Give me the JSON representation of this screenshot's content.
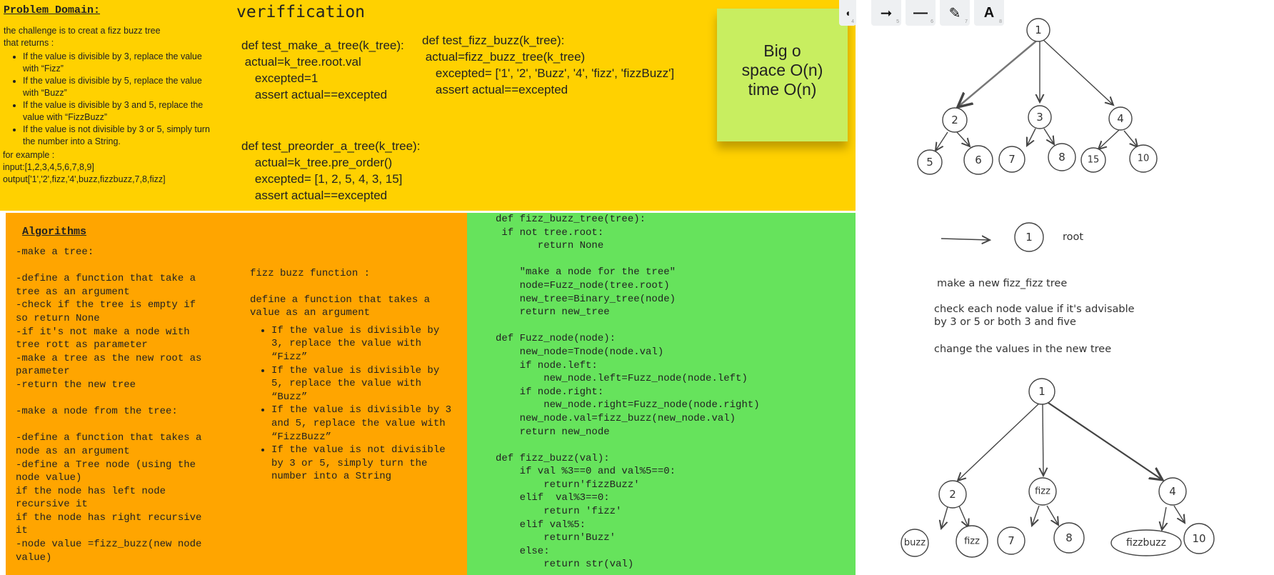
{
  "problem": {
    "title": "Problem Domain:",
    "intro": [
      "the challenge is to creat a fizz buzz tree",
      "that returns :"
    ],
    "rules": [
      "If the value is divisible by 3, replace the value with “Fizz”",
      "If the value is divisible by 5, replace the value with “Buzz”",
      "If the value is divisible by 3 and 5, replace the value with “FizzBuzz”",
      "If the value is not divisible by 3 or 5, simply turn the number into a String."
    ],
    "example_label": "for example :",
    "input": "input:[1,2,3,4,5,6,7,8,9]",
    "output": "output['1','2',fizz,'4',buzz,fizzbuzz,7,8,fizz]"
  },
  "verification": {
    "title": "veriffication",
    "test1": "def test_make_a_tree(k_tree):\n actual=k_tree.root.val\n    excepted=1\n    assert actual==excepted",
    "test2": "def test_fizz_buzz(k_tree):\n actual=fizz_buzz_tree(k_tree)\n    excepted= ['1', '2', 'Buzz', '4', 'fizz', 'fizzBuzz']\n    assert actual==excepted",
    "test3": "def test_preorder_a_tree(k_tree):\n    actual=k_tree.pre_order()\n    excepted= [1, 2, 5, 4, 3, 15]\n    assert actual==excepted"
  },
  "sticky": {
    "line1": "Big o",
    "line2": "space O(n)",
    "line3": "time O(n)"
  },
  "algorithms": {
    "title": "Algorithms",
    "steps": "-make a tree:\n\n-define a function that take a tree as an argument\n-check if the tree is empty if so return None\n-if it's not make a node with tree rott as parameter\n-make a tree as the new root as parameter\n-return the new tree\n\n-make a node from the tree:\n\n-define a function that takes a node as an argument\n-define a Tree node (using the node value)\nif the node has left node recursive it\nif the node has right recursive it\n-node value =fizz_buzz(new node value)",
    "fizz_title": "fizz buzz function :",
    "fizz_desc": "define a function that takes a value as an argument",
    "fizz_rules": [
      "If the value is divisible by 3, replace the value with “Fizz”",
      "If the value is divisible by 5, replace the value with “Buzz”",
      "If the value is divisible by 3 and 5, replace the value with “FizzBuzz”",
      "If the value is not divisible by 3 or 5, simply turn the number into a String"
    ]
  },
  "code": "def fizz_buzz_tree(tree):\n if not tree.root:\n       return None\n\n    \"make a node for the tree\"\n    node=Fuzz_node(tree.root)\n    new_tree=Binary_tree(node)\n    return new_tree\n\ndef Fuzz_node(node):\n    new_node=Tnode(node.val)\n    if node.left:\n        new_node.left=Fuzz_node(node.left)\n    if node.right:\n        new_node.right=Fuzz_node(node.right)\n    new_node.val=fizz_buzz(new_node.val)\n    return new_node\n\ndef fizz_buzz(val):\n    if val %3==0 and val%5==0:\n        return'fizzBuzz'\n    elif  val%3==0:\n        return 'fizz'\n    elif val%5:\n        return'Buzz'\n    else:\n        return str(val)",
  "toolbar": {
    "tools": [
      {
        "icon": "eraser-icon",
        "glyph": "◖",
        "num": "4"
      },
      {
        "icon": "arrow-icon",
        "glyph": "➞",
        "num": "5"
      },
      {
        "icon": "line-icon",
        "glyph": "—",
        "num": "6"
      },
      {
        "icon": "pencil-icon",
        "glyph": "✎",
        "num": "7"
      },
      {
        "icon": "text-icon",
        "glyph": "A",
        "num": "8"
      }
    ]
  },
  "diagram": {
    "tree1": [
      "1",
      "2",
      "3",
      "4",
      "5",
      "6",
      "7",
      "8",
      "15",
      "10"
    ],
    "legend_node": "1",
    "legend_label": "root",
    "notes": [
      "make a new fizz_fizz tree",
      "check each node value if it's advisable",
      "by 3 or 5 or both 3 and five",
      "change the values in the new tree"
    ],
    "tree2": [
      "1",
      "2",
      "fizz",
      "4",
      "buzz",
      "fizz",
      "7",
      "8",
      "fizzbuzz",
      "10"
    ]
  }
}
